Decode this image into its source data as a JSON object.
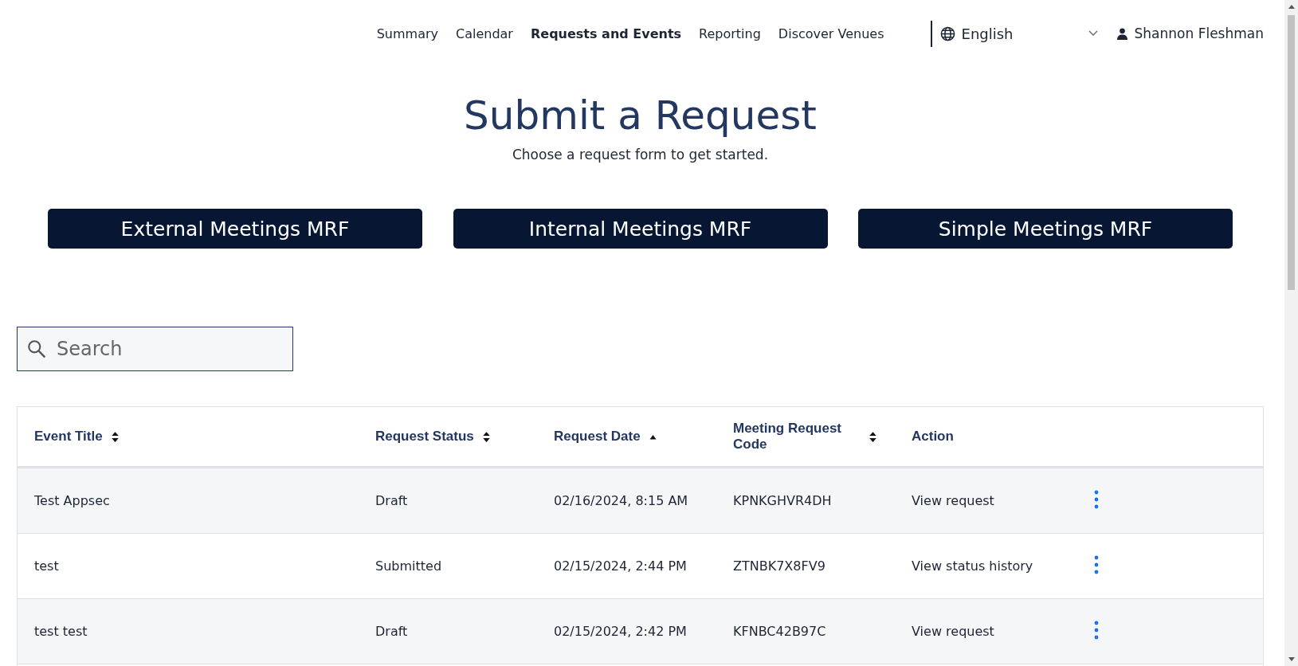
{
  "nav": {
    "items": [
      {
        "label": "Summary",
        "selected": false
      },
      {
        "label": "Calendar",
        "selected": false
      },
      {
        "label": "Requests and Events",
        "selected": true
      },
      {
        "label": "Reporting",
        "selected": false
      },
      {
        "label": "Discover Venues",
        "selected": false
      }
    ],
    "language": "English",
    "user": "Shannon Fleshman"
  },
  "heading": {
    "title": "Submit a Request",
    "subtitle": "Choose a request form to get started."
  },
  "form_buttons": [
    "External Meetings MRF",
    "Internal Meetings MRF",
    "Simple Meetings MRF"
  ],
  "search": {
    "placeholder": "Search"
  },
  "table": {
    "columns": [
      {
        "label": "Event Title",
        "sortable": true,
        "sorted": false
      },
      {
        "label": "Request Status",
        "sortable": true,
        "sorted": false
      },
      {
        "label": "Request Date",
        "sortable": true,
        "sorted": true
      },
      {
        "label": "Meeting Request Code",
        "sortable": true,
        "sorted": false
      },
      {
        "label": "Action",
        "sortable": false,
        "sorted": false
      }
    ],
    "rows": [
      {
        "cells": [
          "Test Appsec",
          "Draft",
          "02/16/2024, 8:15 AM",
          "KPNKGHVR4DH"
        ],
        "action": "View request"
      },
      {
        "cells": [
          "test",
          "Submitted",
          "02/15/2024, 2:44 PM",
          "ZTNBK7X8FV9"
        ],
        "action": "View status history"
      },
      {
        "cells": [
          "test test",
          "Draft",
          "02/15/2024, 2:42 PM",
          "KFNBC42B97C"
        ],
        "action": "View request"
      }
    ]
  }
}
